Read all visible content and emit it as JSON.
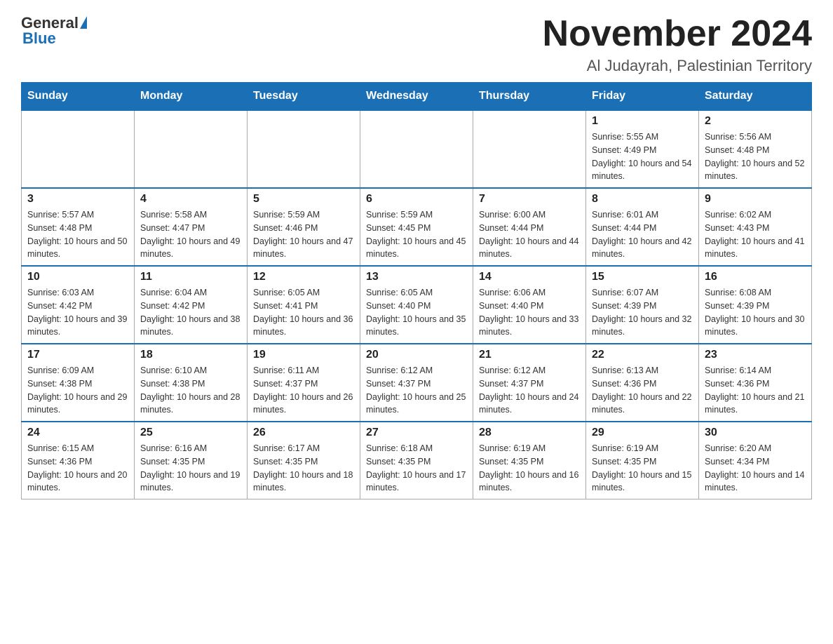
{
  "header": {
    "logo_general": "General",
    "logo_blue": "Blue",
    "month_title": "November 2024",
    "location": "Al Judayrah, Palestinian Territory"
  },
  "days_of_week": [
    "Sunday",
    "Monday",
    "Tuesday",
    "Wednesday",
    "Thursday",
    "Friday",
    "Saturday"
  ],
  "weeks": [
    {
      "days": [
        {
          "num": "",
          "sunrise": "",
          "sunset": "",
          "daylight": "",
          "empty": true
        },
        {
          "num": "",
          "sunrise": "",
          "sunset": "",
          "daylight": "",
          "empty": true
        },
        {
          "num": "",
          "sunrise": "",
          "sunset": "",
          "daylight": "",
          "empty": true
        },
        {
          "num": "",
          "sunrise": "",
          "sunset": "",
          "daylight": "",
          "empty": true
        },
        {
          "num": "",
          "sunrise": "",
          "sunset": "",
          "daylight": "",
          "empty": true
        },
        {
          "num": "1",
          "sunrise": "Sunrise: 5:55 AM",
          "sunset": "Sunset: 4:49 PM",
          "daylight": "Daylight: 10 hours and 54 minutes.",
          "empty": false
        },
        {
          "num": "2",
          "sunrise": "Sunrise: 5:56 AM",
          "sunset": "Sunset: 4:48 PM",
          "daylight": "Daylight: 10 hours and 52 minutes.",
          "empty": false
        }
      ]
    },
    {
      "days": [
        {
          "num": "3",
          "sunrise": "Sunrise: 5:57 AM",
          "sunset": "Sunset: 4:48 PM",
          "daylight": "Daylight: 10 hours and 50 minutes.",
          "empty": false
        },
        {
          "num": "4",
          "sunrise": "Sunrise: 5:58 AM",
          "sunset": "Sunset: 4:47 PM",
          "daylight": "Daylight: 10 hours and 49 minutes.",
          "empty": false
        },
        {
          "num": "5",
          "sunrise": "Sunrise: 5:59 AM",
          "sunset": "Sunset: 4:46 PM",
          "daylight": "Daylight: 10 hours and 47 minutes.",
          "empty": false
        },
        {
          "num": "6",
          "sunrise": "Sunrise: 5:59 AM",
          "sunset": "Sunset: 4:45 PM",
          "daylight": "Daylight: 10 hours and 45 minutes.",
          "empty": false
        },
        {
          "num": "7",
          "sunrise": "Sunrise: 6:00 AM",
          "sunset": "Sunset: 4:44 PM",
          "daylight": "Daylight: 10 hours and 44 minutes.",
          "empty": false
        },
        {
          "num": "8",
          "sunrise": "Sunrise: 6:01 AM",
          "sunset": "Sunset: 4:44 PM",
          "daylight": "Daylight: 10 hours and 42 minutes.",
          "empty": false
        },
        {
          "num": "9",
          "sunrise": "Sunrise: 6:02 AM",
          "sunset": "Sunset: 4:43 PM",
          "daylight": "Daylight: 10 hours and 41 minutes.",
          "empty": false
        }
      ]
    },
    {
      "days": [
        {
          "num": "10",
          "sunrise": "Sunrise: 6:03 AM",
          "sunset": "Sunset: 4:42 PM",
          "daylight": "Daylight: 10 hours and 39 minutes.",
          "empty": false
        },
        {
          "num": "11",
          "sunrise": "Sunrise: 6:04 AM",
          "sunset": "Sunset: 4:42 PM",
          "daylight": "Daylight: 10 hours and 38 minutes.",
          "empty": false
        },
        {
          "num": "12",
          "sunrise": "Sunrise: 6:05 AM",
          "sunset": "Sunset: 4:41 PM",
          "daylight": "Daylight: 10 hours and 36 minutes.",
          "empty": false
        },
        {
          "num": "13",
          "sunrise": "Sunrise: 6:05 AM",
          "sunset": "Sunset: 4:40 PM",
          "daylight": "Daylight: 10 hours and 35 minutes.",
          "empty": false
        },
        {
          "num": "14",
          "sunrise": "Sunrise: 6:06 AM",
          "sunset": "Sunset: 4:40 PM",
          "daylight": "Daylight: 10 hours and 33 minutes.",
          "empty": false
        },
        {
          "num": "15",
          "sunrise": "Sunrise: 6:07 AM",
          "sunset": "Sunset: 4:39 PM",
          "daylight": "Daylight: 10 hours and 32 minutes.",
          "empty": false
        },
        {
          "num": "16",
          "sunrise": "Sunrise: 6:08 AM",
          "sunset": "Sunset: 4:39 PM",
          "daylight": "Daylight: 10 hours and 30 minutes.",
          "empty": false
        }
      ]
    },
    {
      "days": [
        {
          "num": "17",
          "sunrise": "Sunrise: 6:09 AM",
          "sunset": "Sunset: 4:38 PM",
          "daylight": "Daylight: 10 hours and 29 minutes.",
          "empty": false
        },
        {
          "num": "18",
          "sunrise": "Sunrise: 6:10 AM",
          "sunset": "Sunset: 4:38 PM",
          "daylight": "Daylight: 10 hours and 28 minutes.",
          "empty": false
        },
        {
          "num": "19",
          "sunrise": "Sunrise: 6:11 AM",
          "sunset": "Sunset: 4:37 PM",
          "daylight": "Daylight: 10 hours and 26 minutes.",
          "empty": false
        },
        {
          "num": "20",
          "sunrise": "Sunrise: 6:12 AM",
          "sunset": "Sunset: 4:37 PM",
          "daylight": "Daylight: 10 hours and 25 minutes.",
          "empty": false
        },
        {
          "num": "21",
          "sunrise": "Sunrise: 6:12 AM",
          "sunset": "Sunset: 4:37 PM",
          "daylight": "Daylight: 10 hours and 24 minutes.",
          "empty": false
        },
        {
          "num": "22",
          "sunrise": "Sunrise: 6:13 AM",
          "sunset": "Sunset: 4:36 PM",
          "daylight": "Daylight: 10 hours and 22 minutes.",
          "empty": false
        },
        {
          "num": "23",
          "sunrise": "Sunrise: 6:14 AM",
          "sunset": "Sunset: 4:36 PM",
          "daylight": "Daylight: 10 hours and 21 minutes.",
          "empty": false
        }
      ]
    },
    {
      "days": [
        {
          "num": "24",
          "sunrise": "Sunrise: 6:15 AM",
          "sunset": "Sunset: 4:36 PM",
          "daylight": "Daylight: 10 hours and 20 minutes.",
          "empty": false
        },
        {
          "num": "25",
          "sunrise": "Sunrise: 6:16 AM",
          "sunset": "Sunset: 4:35 PM",
          "daylight": "Daylight: 10 hours and 19 minutes.",
          "empty": false
        },
        {
          "num": "26",
          "sunrise": "Sunrise: 6:17 AM",
          "sunset": "Sunset: 4:35 PM",
          "daylight": "Daylight: 10 hours and 18 minutes.",
          "empty": false
        },
        {
          "num": "27",
          "sunrise": "Sunrise: 6:18 AM",
          "sunset": "Sunset: 4:35 PM",
          "daylight": "Daylight: 10 hours and 17 minutes.",
          "empty": false
        },
        {
          "num": "28",
          "sunrise": "Sunrise: 6:19 AM",
          "sunset": "Sunset: 4:35 PM",
          "daylight": "Daylight: 10 hours and 16 minutes.",
          "empty": false
        },
        {
          "num": "29",
          "sunrise": "Sunrise: 6:19 AM",
          "sunset": "Sunset: 4:35 PM",
          "daylight": "Daylight: 10 hours and 15 minutes.",
          "empty": false
        },
        {
          "num": "30",
          "sunrise": "Sunrise: 6:20 AM",
          "sunset": "Sunset: 4:34 PM",
          "daylight": "Daylight: 10 hours and 14 minutes.",
          "empty": false
        }
      ]
    }
  ]
}
